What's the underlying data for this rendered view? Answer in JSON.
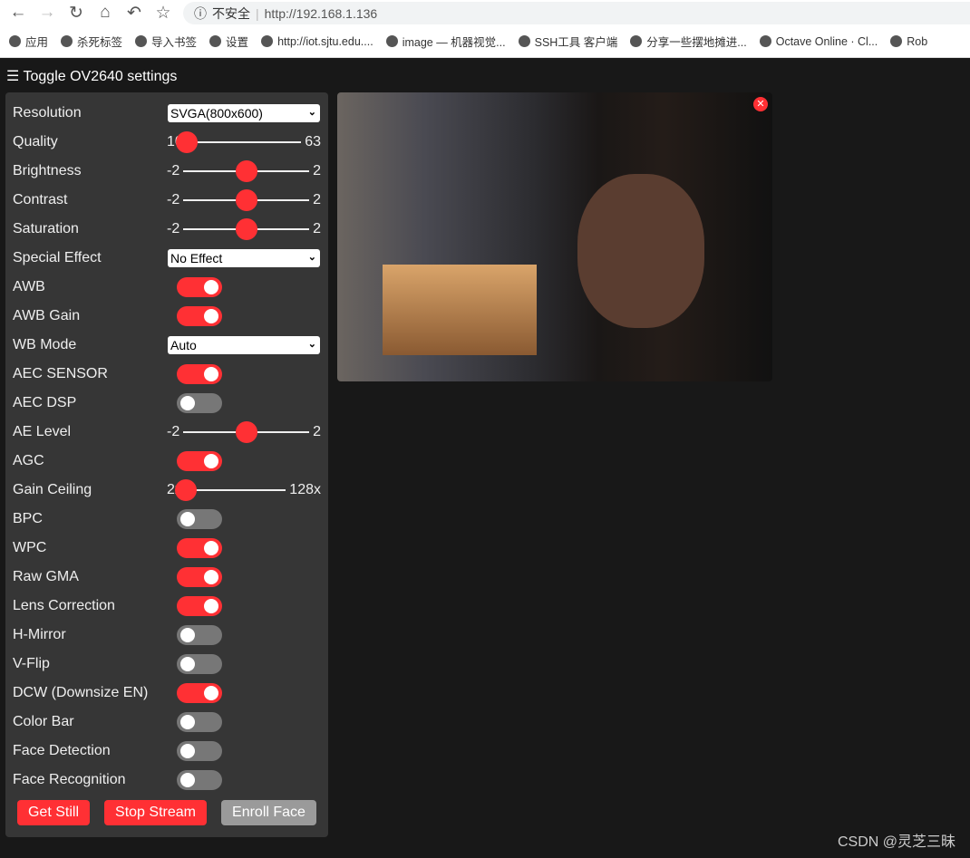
{
  "browser": {
    "security": "不安全",
    "url": "http://192.168.1.136",
    "bookmarks": [
      "应用",
      "杀死标签",
      "导入书签",
      "设置",
      "http://iot.sjtu.edu....",
      "image — 机器视觉...",
      "SSH工具 客户端",
      "分享一些摆地摊进...",
      "Octave Online · Cl...",
      "Rob"
    ]
  },
  "toggle_label": "Toggle OV2640 settings",
  "controls": [
    {
      "label": "Resolution",
      "type": "select",
      "value": "SVGA(800x600)"
    },
    {
      "label": "Quality",
      "type": "range",
      "min": "10",
      "max": "63",
      "value": 10
    },
    {
      "label": "Brightness",
      "type": "range",
      "min": "-2",
      "max": "2",
      "value": 0
    },
    {
      "label": "Contrast",
      "type": "range",
      "min": "-2",
      "max": "2",
      "value": 0
    },
    {
      "label": "Saturation",
      "type": "range",
      "min": "-2",
      "max": "2",
      "value": 0
    },
    {
      "label": "Special Effect",
      "type": "select",
      "value": "No Effect"
    },
    {
      "label": "AWB",
      "type": "toggle",
      "on": true
    },
    {
      "label": "AWB Gain",
      "type": "toggle",
      "on": true
    },
    {
      "label": "WB Mode",
      "type": "select",
      "value": "Auto"
    },
    {
      "label": "AEC SENSOR",
      "type": "toggle",
      "on": true
    },
    {
      "label": "AEC DSP",
      "type": "toggle",
      "on": false
    },
    {
      "label": "AE Level",
      "type": "range",
      "min": "-2",
      "max": "2",
      "value": 0
    },
    {
      "label": "AGC",
      "type": "toggle",
      "on": true
    },
    {
      "label": "Gain Ceiling",
      "type": "range",
      "min": "2x",
      "max": "128x",
      "value": 0
    },
    {
      "label": "BPC",
      "type": "toggle",
      "on": false
    },
    {
      "label": "WPC",
      "type": "toggle",
      "on": true
    },
    {
      "label": "Raw GMA",
      "type": "toggle",
      "on": true
    },
    {
      "label": "Lens Correction",
      "type": "toggle",
      "on": true
    },
    {
      "label": "H-Mirror",
      "type": "toggle",
      "on": false
    },
    {
      "label": "V-Flip",
      "type": "toggle",
      "on": false
    },
    {
      "label": "DCW (Downsize EN)",
      "type": "toggle",
      "on": true
    },
    {
      "label": "Color Bar",
      "type": "toggle",
      "on": false
    },
    {
      "label": "Face Detection",
      "type": "toggle",
      "on": false
    },
    {
      "label": "Face Recognition",
      "type": "toggle",
      "on": false
    }
  ],
  "buttons": {
    "get_still": "Get Still",
    "stop_stream": "Stop Stream",
    "enroll_face": "Enroll Face"
  },
  "close_glyph": "✕",
  "watermark": "CSDN @灵芝三昧",
  "colors": {
    "accent": "#ff3034",
    "panel": "#363636",
    "background": "#181818",
    "disabled_button": "#9a9a9a"
  }
}
